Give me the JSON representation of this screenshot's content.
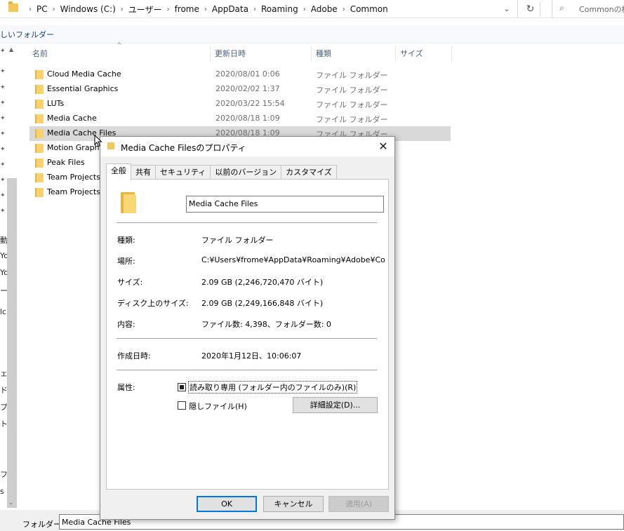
{
  "address_bar": {
    "crumbs": [
      "PC",
      "Windows (C:)",
      "ユーザー",
      "frome",
      "AppData",
      "Roaming",
      "Adobe",
      "Common"
    ],
    "search_placeholder": "Commonの検索"
  },
  "toolbar": {
    "new_folder_label": "しいフォルダー"
  },
  "columns": {
    "name": "名前",
    "date": "更新日時",
    "type": "種類",
    "size": "サイズ"
  },
  "files": [
    {
      "name": "Cloud Media Cache",
      "date": "2020/08/01 0:06",
      "type": "ファイル フォルダー"
    },
    {
      "name": "Essential Graphics",
      "date": "2020/02/02 1:37",
      "type": "ファイル フォルダー"
    },
    {
      "name": "LUTs",
      "date": "2020/03/22 15:54",
      "type": "ファイル フォルダー"
    },
    {
      "name": "Media Cache",
      "date": "2020/08/18 1:09",
      "type": "ファイル フォルダー"
    },
    {
      "name": "Media Cache Files",
      "date": "2020/08/18 1:09",
      "type": "ファイル フォルダー"
    },
    {
      "name": "Motion Graphics Templates",
      "date": "",
      "type": ""
    },
    {
      "name": "Peak Files",
      "date": "",
      "type": ""
    },
    {
      "name": "Team Projects Cache",
      "date": "",
      "type": ""
    },
    {
      "name": "Team Projects Local Hub",
      "date": "",
      "type": ""
    }
  ],
  "nav_fragments": [
    "動",
    "Yo",
    "Yo",
    "ー",
    "lc",
    "ェ",
    "ド",
    "プ",
    "ト",
    "フ",
    "s"
  ],
  "folder_bar": {
    "label": "フォルダー:",
    "value": "Media Cache Files"
  },
  "dialog": {
    "title": "Media Cache Filesのプロパティ",
    "close": "✕",
    "tabs": [
      "全般",
      "共有",
      "セキュリティ",
      "以前のバージョン",
      "カスタマイズ"
    ],
    "folder_name": "Media Cache Files",
    "props": {
      "type_label": "種類:",
      "type_value": "ファイル フォルダー",
      "location_label": "場所:",
      "location_value": "C:¥Users¥frome¥AppData¥Roaming¥Adobe¥Common",
      "size_label": "サイズ:",
      "size_value": "2.09 GB (2,246,720,470 バイト)",
      "disk_size_label": "ディスク上のサイズ:",
      "disk_size_value": "2.09 GB (2,249,166,848 バイト)",
      "contents_label": "内容:",
      "contents_value": "ファイル数: 4,398、フォルダー数: 0",
      "created_label": "作成日時:",
      "created_value": "2020年1月12日、10:06:07",
      "attributes_label": "属性:"
    },
    "attributes": {
      "readonly_label": "読み取り専用 (フォルダー内のファイルのみ)(R)",
      "hidden_label": "隠しファイル(H)",
      "advanced_button": "詳細設定(D)..."
    },
    "buttons": {
      "ok": "OK",
      "cancel": "キャンセル",
      "apply": "適用(A)"
    }
  }
}
